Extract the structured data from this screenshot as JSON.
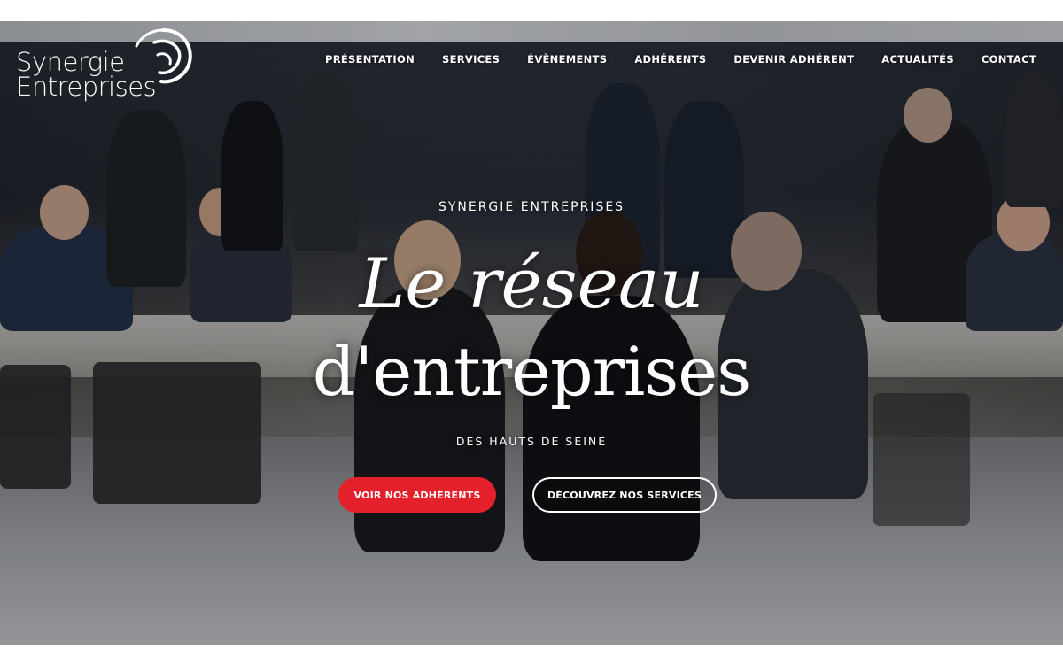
{
  "brand": {
    "line1": "Synergie",
    "line2": "Entreprises",
    "mark_icon": "swirl-logo-icon"
  },
  "nav": {
    "items": [
      {
        "label": "PRÉSENTATION"
      },
      {
        "label": "SERVICES"
      },
      {
        "label": "ÉVÈNEMENTS"
      },
      {
        "label": "ADHÉRENTS"
      },
      {
        "label": "DEVENIR ADHÉRENT"
      },
      {
        "label": "ACTUALITÉS"
      },
      {
        "label": "CONTACT"
      }
    ]
  },
  "hero": {
    "eyebrow": "SYNERGIE ENTREPRISES",
    "headline_line1": "Le réseau",
    "headline_line2": "d'entreprises",
    "subline": "DES HAUTS DE SEINE",
    "primary_button": "VOIR NOS ADHÉRENTS",
    "secondary_button": "DÉCOUVREZ NOS SERVICES"
  },
  "colors": {
    "accent": "#e4202a",
    "text": "#ffffff"
  }
}
